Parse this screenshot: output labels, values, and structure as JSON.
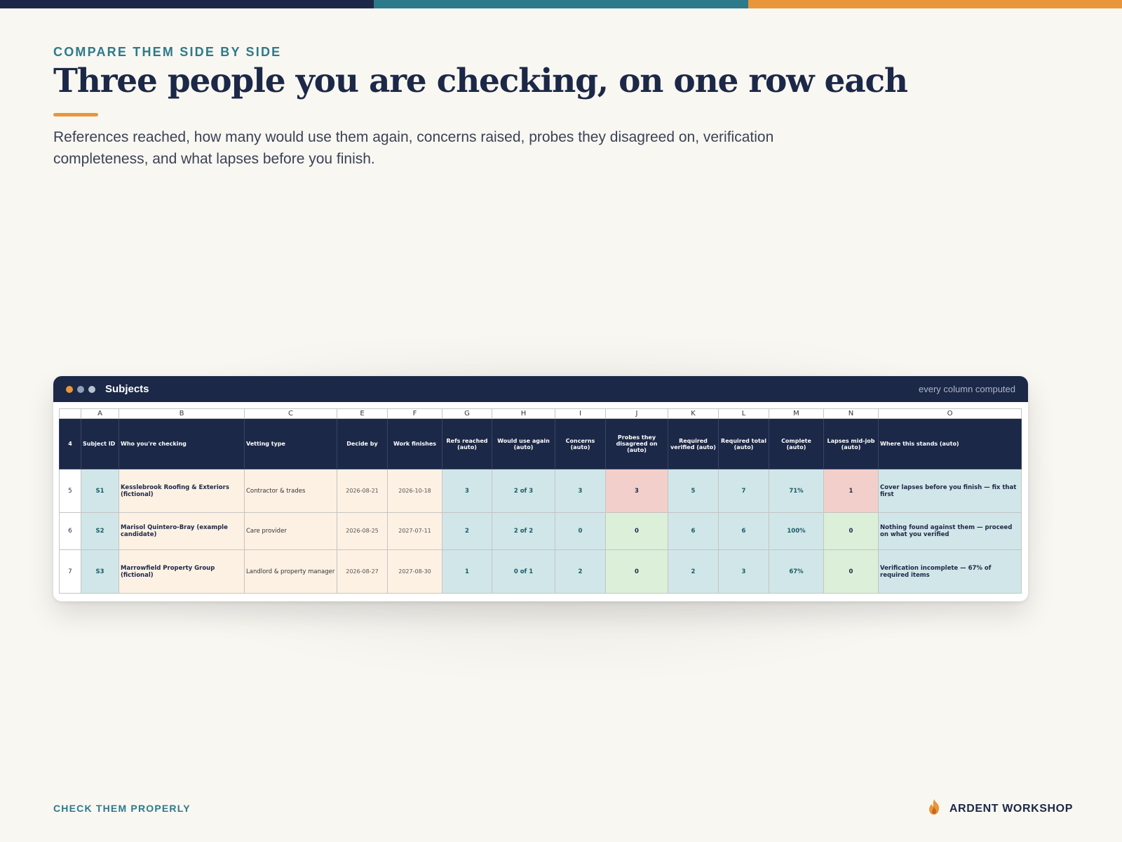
{
  "colors": {
    "navy": "#1c2847",
    "teal": "#2c7a8a",
    "orange": "#e9963a"
  },
  "eyebrow": "COMPARE THEM SIDE BY SIDE",
  "title": "Three people you are checking, on one row each",
  "subtitle": "References reached, how many would use them again, concerns raised, probes they disagreed on, verification completeness, and what lapses before you finish.",
  "window": {
    "title": "Subjects",
    "note": "every column computed"
  },
  "sheet": {
    "columns": [
      "A",
      "B",
      "C",
      "E",
      "F",
      "G",
      "H",
      "I",
      "J",
      "K",
      "L",
      "M",
      "N",
      "O"
    ],
    "header_row_number": "4",
    "headers": [
      "Subject ID",
      "Who you're checking",
      "Vetting type",
      "Decide by",
      "Work finishes",
      "Refs reached (auto)",
      "Would use again (auto)",
      "Concerns (auto)",
      "Probes they disagreed on (auto)",
      "Required verified (auto)",
      "Required total (auto)",
      "Complete (auto)",
      "Lapses mid-job (auto)",
      "Where this stands (auto)"
    ],
    "rows": [
      {
        "n": "5",
        "id": "S1",
        "who": "Kesslebrook Roofing & Exteriors (fictional)",
        "type": "Contractor & trades",
        "decide": "2026-08-21",
        "finish": "2026-10-18",
        "refs": "3",
        "again": "2 of 3",
        "concerns": "3",
        "probes": "3",
        "verified": "5",
        "total": "7",
        "complete": "71%",
        "lapses": "1",
        "stands": "Cover lapses before you finish — fix that first"
      },
      {
        "n": "6",
        "id": "S2",
        "who": "Marisol Quintero-Bray (example candidate)",
        "type": "Care provider",
        "decide": "2026-08-25",
        "finish": "2027-07-11",
        "refs": "2",
        "again": "2 of 2",
        "concerns": "0",
        "probes": "0",
        "verified": "6",
        "total": "6",
        "complete": "100%",
        "lapses": "0",
        "stands": "Nothing found against them — proceed on what you verified"
      },
      {
        "n": "7",
        "id": "S3",
        "who": "Marrowfield Property Group (fictional)",
        "type": "Landlord & property manager",
        "decide": "2026-08-27",
        "finish": "2027-08-30",
        "refs": "1",
        "again": "0 of 1",
        "concerns": "2",
        "probes": "0",
        "verified": "2",
        "total": "3",
        "complete": "67%",
        "lapses": "0",
        "stands": "Verification incomplete — 67% of required items"
      }
    ]
  },
  "footer": {
    "left": "CHECK THEM PROPERLY",
    "brand": "ARDENT WORKSHOP"
  }
}
